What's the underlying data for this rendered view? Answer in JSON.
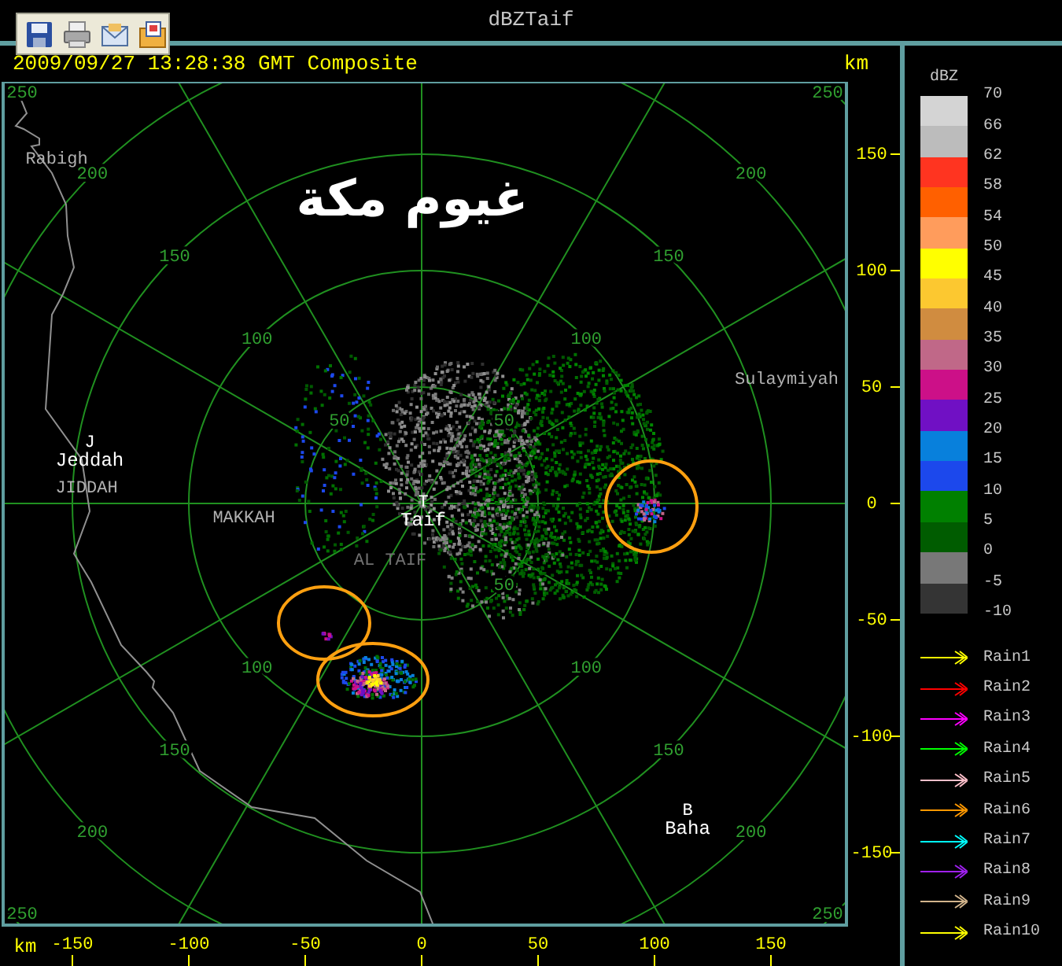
{
  "window": {
    "title": "dBZTaif"
  },
  "toolbar": {
    "buttons": [
      {
        "kind": "save"
      },
      {
        "kind": "print"
      },
      {
        "kind": "mail"
      },
      {
        "kind": "export"
      }
    ]
  },
  "header": {
    "timestamp": "2009/09/27 13:28:38 GMT Composite",
    "unit": "km"
  },
  "map": {
    "title": "غيوم مكة",
    "range_rings": [
      {
        "labels": [
          "50",
          "50",
          "50"
        ]
      },
      {
        "labels": [
          "100",
          "100",
          "100",
          "100"
        ]
      },
      {
        "labels": [
          "150",
          "150",
          "150",
          "150"
        ]
      },
      {
        "labels": [
          "200",
          "200",
          "200",
          "200"
        ]
      },
      {
        "labels": [
          "250",
          "250",
          "250",
          "250"
        ]
      }
    ],
    "places": [
      {
        "kind": "region",
        "name": "Rabigh"
      },
      {
        "kind": "city",
        "marker": "J",
        "name": "Jeddah"
      },
      {
        "kind": "region",
        "name": "JIDDAH"
      },
      {
        "kind": "region",
        "name": "MAKKAH"
      },
      {
        "kind": "city",
        "marker": "T",
        "name": "Taif"
      },
      {
        "kind": "faint",
        "name": "AL TAIF"
      },
      {
        "kind": "region",
        "name": "Sulaymiyah"
      },
      {
        "kind": "city",
        "marker": "B",
        "name": "Baha"
      }
    ]
  },
  "y_axis": {
    "ticks": [
      "150",
      "100",
      "50",
      "0",
      "-50",
      "-100",
      "-150"
    ]
  },
  "x_axis": {
    "unit": "km",
    "ticks": [
      "-150",
      "-100",
      "-50",
      "0",
      "50",
      "100",
      "150"
    ]
  },
  "legend": {
    "title": "dBZ",
    "scale": [
      "70",
      "66",
      "62",
      "58",
      "54",
      "50",
      "45",
      "40",
      "35",
      "30",
      "25",
      "20",
      "15",
      "10",
      "5",
      "0",
      "-5",
      "-10"
    ],
    "bins": [
      {
        "color": "#d4d4d4"
      },
      {
        "color": "#bcbcbc"
      },
      {
        "color": "#ff3420"
      },
      {
        "color": "#ff6000"
      },
      {
        "color": "#ff9c5c"
      },
      {
        "color": "#ffff00"
      },
      {
        "color": "#fcc830"
      },
      {
        "color": "#d08c40"
      },
      {
        "color": "#c06888"
      },
      {
        "color": "#cc1088"
      },
      {
        "color": "#7010c4"
      },
      {
        "color": "#0880dc"
      },
      {
        "color": "#1c48ec"
      },
      {
        "color": "#008000"
      },
      {
        "color": "#005c00"
      },
      {
        "color": "#787878"
      },
      {
        "color": "#343434"
      }
    ],
    "tracks": [
      {
        "label": "Rain1",
        "color": "#ffff00"
      },
      {
        "label": "Rain2",
        "color": "#ff0000"
      },
      {
        "label": "Rain3",
        "color": "#ff00ff"
      },
      {
        "label": "Rain4",
        "color": "#00ff00"
      },
      {
        "label": "Rain5",
        "color": "#ffc0cb"
      },
      {
        "label": "Rain6",
        "color": "#ff9800"
      },
      {
        "label": "Rain7",
        "color": "#00ffff"
      },
      {
        "label": "Rain8",
        "color": "#a020f0"
      },
      {
        "label": "Rain9",
        "color": "#d2b48c"
      },
      {
        "label": "Rain10",
        "color": "#ffff00"
      }
    ]
  }
}
